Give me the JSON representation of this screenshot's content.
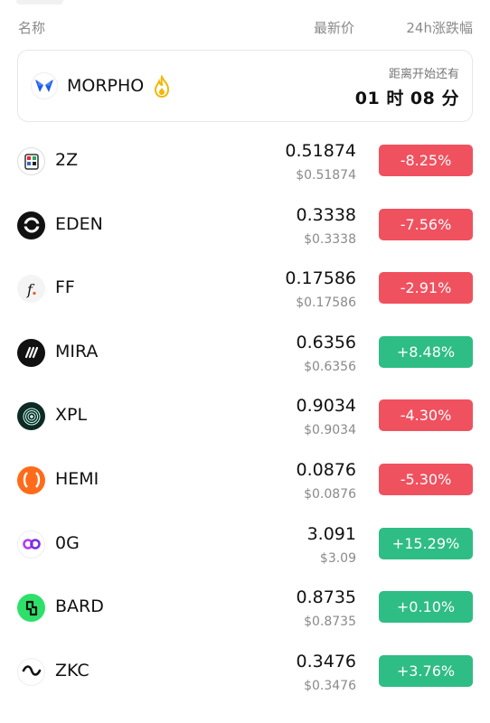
{
  "header": {
    "name_label": "名称",
    "price_label": "最新价",
    "change_label": "24h涨跌幅"
  },
  "promo": {
    "symbol": "MORPHO",
    "icon": "morpho-butterfly-icon",
    "badge_icon": "fire-icon",
    "countdown_label": "距离开始还有",
    "countdown_value": "01 时 08 分"
  },
  "colors": {
    "down": "#f0515f",
    "up": "#2ebd85"
  },
  "rows": [
    {
      "symbol": "2Z",
      "icon": "2z-logo-icon",
      "price": "0.51874",
      "usd": "$0.51874",
      "change": "-8.25%",
      "direction": "down"
    },
    {
      "symbol": "EDEN",
      "icon": "eden-logo-icon",
      "price": "0.3338",
      "usd": "$0.3338",
      "change": "-7.56%",
      "direction": "down"
    },
    {
      "symbol": "FF",
      "icon": "ff-logo-icon",
      "price": "0.17586",
      "usd": "$0.17586",
      "change": "-2.91%",
      "direction": "down"
    },
    {
      "symbol": "MIRA",
      "icon": "mira-logo-icon",
      "price": "0.6356",
      "usd": "$0.6356",
      "change": "+8.48%",
      "direction": "up"
    },
    {
      "symbol": "XPL",
      "icon": "xpl-logo-icon",
      "price": "0.9034",
      "usd": "$0.9034",
      "change": "-4.30%",
      "direction": "down"
    },
    {
      "symbol": "HEMI",
      "icon": "hemi-logo-icon",
      "price": "0.0876",
      "usd": "$0.0876",
      "change": "-5.30%",
      "direction": "down"
    },
    {
      "symbol": "0G",
      "icon": "0g-logo-icon",
      "price": "3.091",
      "usd": "$3.09",
      "change": "+15.29%",
      "direction": "up"
    },
    {
      "symbol": "BARD",
      "icon": "bard-logo-icon",
      "price": "0.8735",
      "usd": "$0.8735",
      "change": "+0.10%",
      "direction": "up"
    },
    {
      "symbol": "ZKC",
      "icon": "zkc-logo-icon",
      "price": "0.3476",
      "usd": "$0.3476",
      "change": "+3.76%",
      "direction": "up"
    }
  ]
}
